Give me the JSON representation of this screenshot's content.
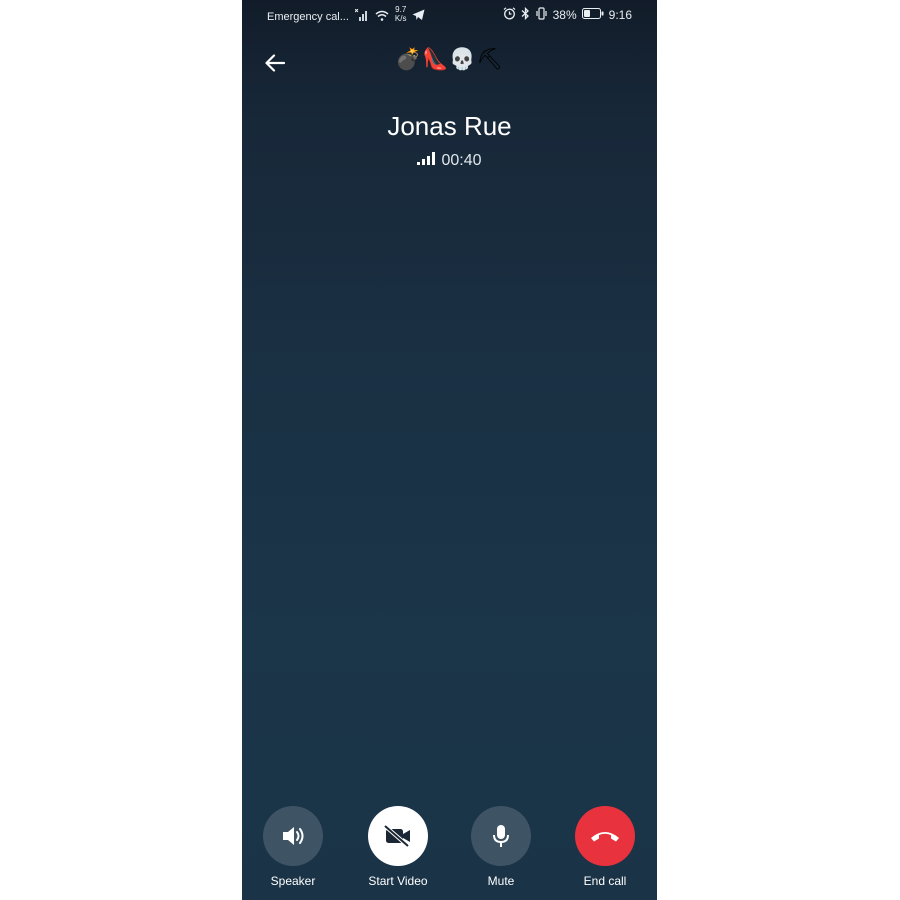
{
  "status_bar": {
    "carrier": "Emergency cal...",
    "speed_value": "9.7",
    "speed_unit": "K/s",
    "battery": "38%",
    "time": "9:16"
  },
  "header": {
    "emojis": "💣👠💀⛏"
  },
  "call": {
    "contact_name": "Jonas Rue",
    "duration": "00:40"
  },
  "controls": {
    "speaker_label": "Speaker",
    "video_label": "Start Video",
    "mute_label": "Mute",
    "end_label": "End call"
  },
  "colors": {
    "end_call": "#e8333e",
    "background_top": "#121c29",
    "background_bottom": "#1b3549"
  }
}
